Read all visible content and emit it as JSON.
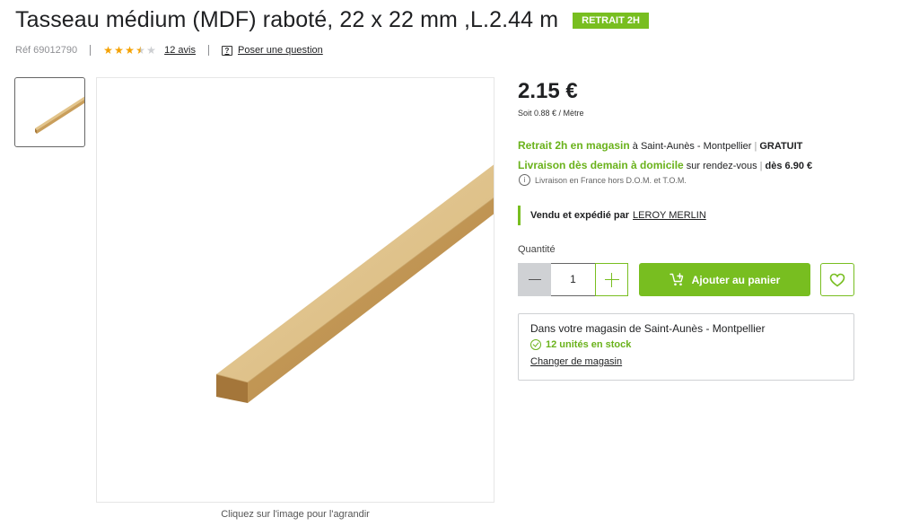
{
  "product": {
    "title": "Tasseau médium (MDF) raboté, 22 x 22 mm ,L.2.44 m",
    "badge": "RETRAIT 2H",
    "ref": "Réf 69012790",
    "rating": 3.5,
    "reviews_label": "12 avis",
    "question_label": "Poser une question"
  },
  "gallery": {
    "caption": "Cliquez sur l'image pour l'agrandir"
  },
  "pricing": {
    "price": "2.15 €",
    "unit_price": "Soit 0.88 € / Mètre"
  },
  "delivery": {
    "pickup_label": "Retrait 2h en magasin",
    "pickup_location": "à Saint-Aunès - Montpellier",
    "pickup_price": "GRATUIT",
    "home_label": "Livraison dès demain à domicile",
    "home_detail": "sur rendez-vous",
    "home_price": "dès 6.90 €",
    "info": "Livraison en France hors D.O.M. et T.O.M."
  },
  "seller": {
    "label": "Vendu et expédié par",
    "name": "LEROY MERLIN"
  },
  "quantity": {
    "label": "Quantité",
    "value": "1"
  },
  "cart": {
    "add_label": "Ajouter au panier"
  },
  "store": {
    "name": "Dans votre magasin de Saint-Aunès - Montpellier",
    "stock": "12 unités en stock",
    "change_label": "Changer de magasin"
  },
  "colors": {
    "accent": "#78be20",
    "star": "#f4a100"
  }
}
